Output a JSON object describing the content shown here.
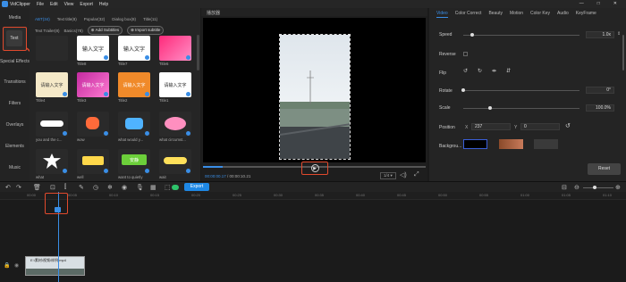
{
  "app": {
    "title": "VidClipper",
    "menu": [
      "File",
      "Edit",
      "View",
      "Export",
      "Help"
    ]
  },
  "left_nav": {
    "items": [
      "Media",
      "Text",
      "Special Effects",
      "Transitions",
      "Filters",
      "Overlays",
      "Elements",
      "Music"
    ]
  },
  "library": {
    "tabs": [
      "ABT(34)",
      "Text title(8)",
      "Popular(32)",
      "Dialog box(8)",
      "Title(11)"
    ],
    "subtabs": [
      "Text Trailer(8)",
      "Basics(78)"
    ],
    "add_subtitles": "Add Subtitles",
    "import_subtitle": "Import subtitle",
    "items": [
      {
        "label": "",
        "style": "blank"
      },
      {
        "label": "Title8",
        "style": "cn",
        "text": "输入文字"
      },
      {
        "label": "Title7",
        "style": "cn",
        "text": "输入文字"
      },
      {
        "label": "Title6",
        "style": "pinkgrad"
      },
      {
        "label": "Title4",
        "style": "cn-small",
        "text": "请输入文字"
      },
      {
        "label": "Title3",
        "style": "purple",
        "text": "请输入文字"
      },
      {
        "label": "Title2",
        "style": "orange",
        "text": "请输入文字"
      },
      {
        "label": "Title1",
        "style": "cn-small",
        "text": "请输入文字"
      },
      {
        "label": "you and the c...",
        "style": "bubble"
      },
      {
        "label": "wow",
        "style": "wow"
      },
      {
        "label": "what would y...",
        "style": "chat"
      },
      {
        "label": "what circumst...",
        "style": "pinkbubble"
      },
      {
        "label": "what",
        "style": "burst"
      },
      {
        "label": "well",
        "style": "well"
      },
      {
        "label": "want to quietly",
        "style": "green",
        "text": "安静"
      },
      {
        "label": "wait",
        "style": "dots"
      }
    ]
  },
  "preview": {
    "header": "播放器",
    "current_time": "00:00:00.17",
    "total_time": "00:00:10.21",
    "quality": "1/4"
  },
  "properties": {
    "tabs": [
      "Video",
      "Color Correct",
      "Beauty",
      "Motion",
      "Color Key",
      "Audio",
      "KeyFrame"
    ],
    "active_tab": "Video",
    "speed_label": "Speed",
    "speed_value": "1.0x",
    "reverse_label": "Reverse",
    "flip_label": "Flip",
    "rotate_label": "Rotate",
    "rotate_value": "0°",
    "scale_label": "Scale",
    "scale_value": "100.0%",
    "position_label": "Position",
    "pos_x_label": "X",
    "pos_x_value": "237",
    "pos_y_label": "Y",
    "pos_y_value": "0",
    "background_label": "Backgrou...",
    "reset_label": "Reset"
  },
  "toolbar": {
    "export_label": "Export"
  },
  "ruler": {
    "ticks": [
      "00:00",
      "00:05",
      "00:10",
      "00:15",
      "00:20",
      "00:25",
      "00:30",
      "00:35",
      "00:40",
      "00:45",
      "00:50",
      "00:55",
      "01:00",
      "01:05",
      "01:10",
      "01:15",
      "01:20"
    ]
  },
  "timeline": {
    "clip_label": "E:\\素材\\视频\\样例.mp4"
  },
  "colors": {
    "accent": "#1e88e5",
    "highlight": "#e14a2d"
  }
}
